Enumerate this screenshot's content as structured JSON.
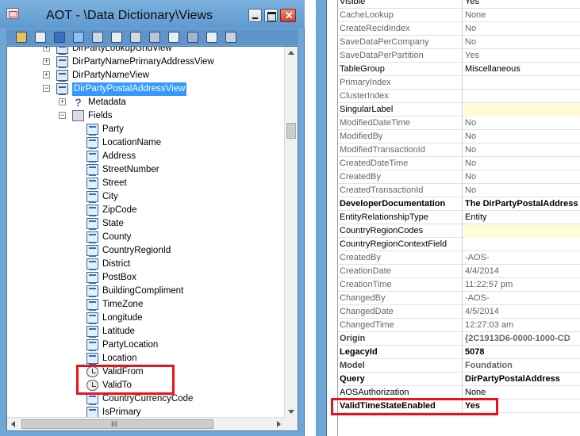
{
  "window": {
    "title": "AOT - \\Data Dictionary\\Views",
    "close_glyph": "✕"
  },
  "toolbar": {
    "icons": [
      "open-icon",
      "properties-icon",
      "save-icon",
      "compile-icon",
      "import-icon",
      "new-icon",
      "duplicate-icon",
      "restore-icon",
      "refresh-icon",
      "go-back-icon",
      "web-icon",
      "find-icon"
    ]
  },
  "tree": {
    "items": [
      {
        "label": "DirPartyLookupGridView",
        "kind": "view",
        "expander": "+"
      },
      {
        "label": "DirPartyNamePrimaryAddressView",
        "kind": "view",
        "expander": "+"
      },
      {
        "label": "DirPartyNameView",
        "kind": "view",
        "expander": "+"
      },
      {
        "label": "DirPartyPostalAddressView",
        "kind": "view",
        "expander": "-",
        "selected": true
      },
      {
        "label": "Metadata",
        "kind": "metadata",
        "expander": "+"
      },
      {
        "label": "Fields",
        "kind": "folder",
        "expander": "-"
      },
      {
        "label": "Party",
        "kind": "field"
      },
      {
        "label": "LocationName",
        "kind": "field"
      },
      {
        "label": "Address",
        "kind": "field"
      },
      {
        "label": "StreetNumber",
        "kind": "field"
      },
      {
        "label": "Street",
        "kind": "field"
      },
      {
        "label": "City",
        "kind": "field"
      },
      {
        "label": "ZipCode",
        "kind": "field"
      },
      {
        "label": "State",
        "kind": "field"
      },
      {
        "label": "County",
        "kind": "field"
      },
      {
        "label": "CountryRegionId",
        "kind": "field"
      },
      {
        "label": "District",
        "kind": "field"
      },
      {
        "label": "PostBox",
        "kind": "field"
      },
      {
        "label": "BuildingCompliment",
        "kind": "field"
      },
      {
        "label": "TimeZone",
        "kind": "field"
      },
      {
        "label": "Longitude",
        "kind": "field"
      },
      {
        "label": "Latitude",
        "kind": "field"
      },
      {
        "label": "PartyLocation",
        "kind": "field"
      },
      {
        "label": "Location",
        "kind": "field"
      },
      {
        "label": "ValidFrom",
        "kind": "date"
      },
      {
        "label": "ValidTo",
        "kind": "date"
      },
      {
        "label": "CountryCurrencyCode",
        "kind": "field"
      },
      {
        "label": "IsPrimary",
        "kind": "field"
      }
    ],
    "hscroll_grip": "III"
  },
  "properties": {
    "rows": [
      {
        "name": "Visible",
        "value": "Yes",
        "style": "normal"
      },
      {
        "name": "CacheLookup",
        "value": "None",
        "style": "ro"
      },
      {
        "name": "CreateRecIdIndex",
        "value": "No",
        "style": "ro"
      },
      {
        "name": "SaveDataPerCompany",
        "value": "No",
        "style": "ro"
      },
      {
        "name": "SaveDataPerPartition",
        "value": "Yes",
        "style": "ro"
      },
      {
        "name": "TableGroup",
        "value": "Miscellaneous",
        "style": "normal"
      },
      {
        "name": "PrimaryIndex",
        "value": "",
        "style": "ro"
      },
      {
        "name": "ClusterIndex",
        "value": "",
        "style": "ro"
      },
      {
        "name": "SingularLabel",
        "value": "",
        "style": "normal",
        "yellow": true
      },
      {
        "name": "ModifiedDateTime",
        "value": "No",
        "style": "ro"
      },
      {
        "name": "ModifiedBy",
        "value": "No",
        "style": "ro"
      },
      {
        "name": "ModifiedTransactionId",
        "value": "No",
        "style": "ro"
      },
      {
        "name": "CreatedDateTime",
        "value": "No",
        "style": "ro"
      },
      {
        "name": "CreatedBy",
        "value": "No",
        "style": "ro"
      },
      {
        "name": "CreatedTransactionId",
        "value": "No",
        "style": "ro"
      },
      {
        "name": "DeveloperDocumentation",
        "value": "The DirPartyPostalAddress",
        "style": "bold"
      },
      {
        "name": "EntityRelationshipType",
        "value": "Entity",
        "style": "normal"
      },
      {
        "name": "CountryRegionCodes",
        "value": "",
        "style": "normal",
        "yellow": true
      },
      {
        "name": "CountryRegionContextField",
        "value": "",
        "style": "normal"
      },
      {
        "name": "CreatedBy",
        "value": "-AOS-",
        "style": "ro"
      },
      {
        "name": "CreationDate",
        "value": "4/4/2014",
        "style": "ro"
      },
      {
        "name": "CreationTime",
        "value": "11:22:57 pm",
        "style": "ro"
      },
      {
        "name": "ChangedBy",
        "value": "-AOS-",
        "style": "ro"
      },
      {
        "name": "ChangedDate",
        "value": "4/5/2014",
        "style": "ro"
      },
      {
        "name": "ChangedTime",
        "value": "12:27:03 am",
        "style": "ro"
      },
      {
        "name": "Origin",
        "value": "{2C1913D6-0000-1000-CD",
        "style": "bold-ro"
      },
      {
        "name": "LegacyId",
        "value": "5078",
        "style": "bold"
      },
      {
        "name": "Model",
        "value": "Foundation",
        "style": "bold-ro"
      },
      {
        "name": "Query",
        "value": "DirPartyPostalAddress",
        "style": "bold"
      },
      {
        "name": "AOSAuthorization",
        "value": "None",
        "style": "normal"
      },
      {
        "name": "ValidTimeStateEnabled",
        "value": "Yes",
        "style": "bold"
      }
    ]
  },
  "colors": {
    "frame": "#6fa6d6",
    "selection": "#3399ff",
    "highlight": "#e8131a",
    "yellow_cell": "#fdfbd8"
  }
}
